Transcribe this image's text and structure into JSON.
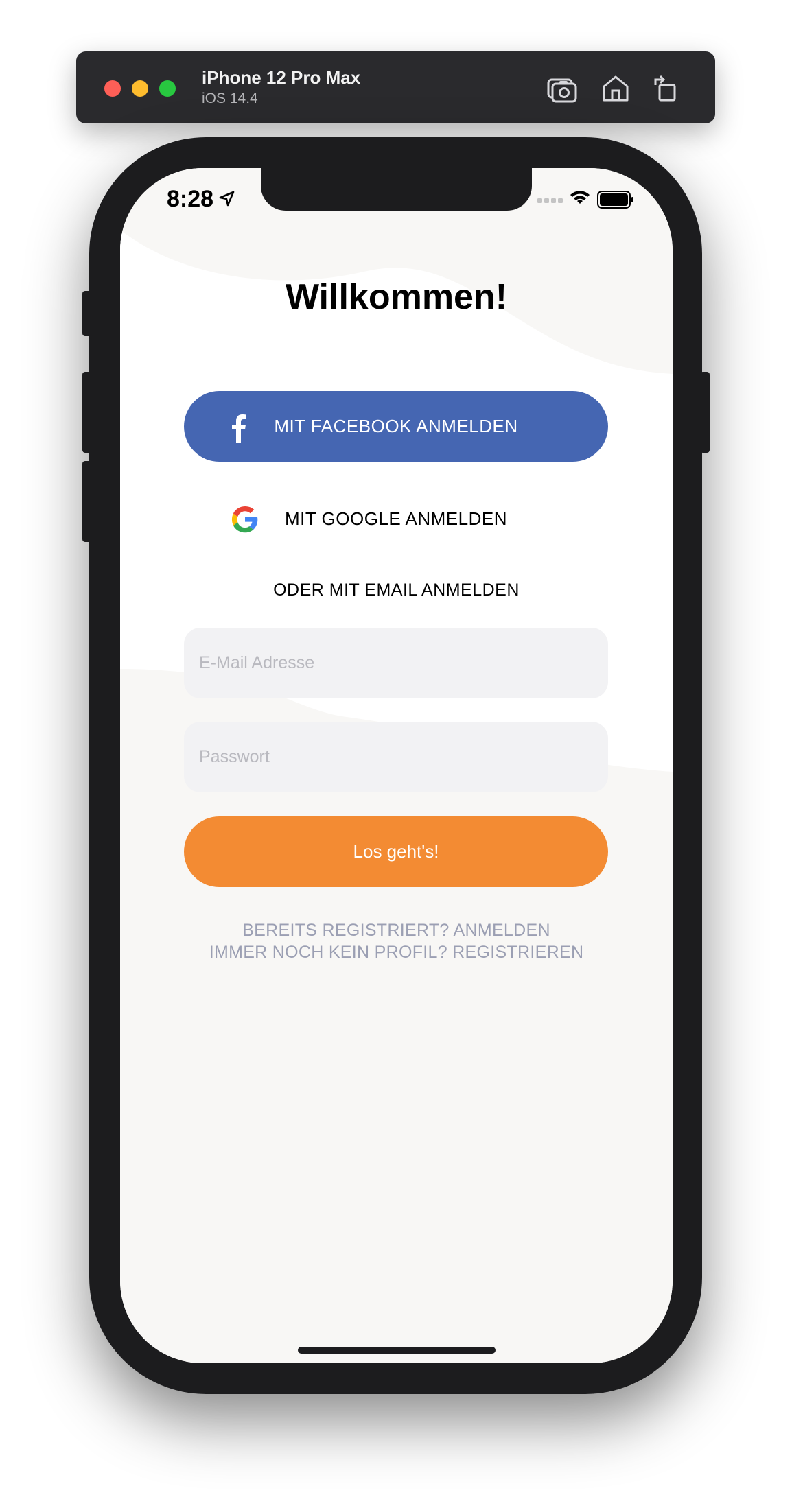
{
  "simulator": {
    "device_name": "iPhone 12 Pro Max",
    "os_version": "iOS 14.4",
    "traffic_lights": [
      "#fe5f57",
      "#febc2e",
      "#28c840"
    ],
    "toolbar_icons": [
      "screenshot-icon",
      "home-icon",
      "rotate-icon"
    ]
  },
  "status_bar": {
    "time": "8:28",
    "icons": [
      "location-arrow-icon",
      "signal-icon",
      "wifi-icon",
      "battery-icon"
    ]
  },
  "screen": {
    "title": "Willkommen!",
    "facebook_button": {
      "label": "MIT FACEBOOK ANMELDEN",
      "icon": "facebook-icon",
      "color": "#4566b2"
    },
    "google_button": {
      "label": "MIT GOOGLE ANMELDEN",
      "icon": "google-icon"
    },
    "email_divider": "ODER MIT EMAIL ANMELDEN",
    "email_field": {
      "placeholder": "E-Mail Adresse",
      "value": ""
    },
    "password_field": {
      "placeholder": "Passwort",
      "value": ""
    },
    "submit_button": {
      "label": "Los geht's!",
      "color": "#f38b33"
    },
    "login_link": "BEREITS REGISTRIERT? ANMELDEN",
    "register_link": "IMMER NOCH KEIN PROFIL? REGISTRIEREN"
  }
}
